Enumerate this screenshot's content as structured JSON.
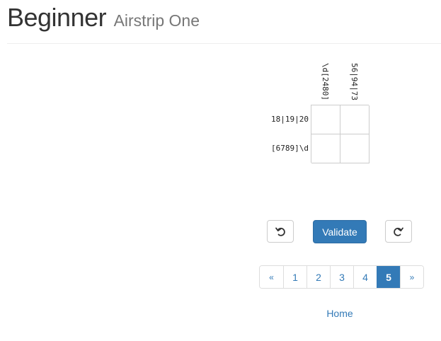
{
  "header": {
    "title": "Beginner",
    "subtitle": "Airstrip One"
  },
  "puzzle": {
    "column_clues": [
      "\\d[2480]",
      "56|94|73"
    ],
    "row_clues": [
      "18|19|20",
      "[6789]\\d"
    ],
    "cells": [
      [
        "",
        ""
      ],
      [
        "",
        ""
      ]
    ]
  },
  "controls": {
    "undo_icon": "undo-icon",
    "redo_icon": "redo-icon",
    "validate_label": "Validate"
  },
  "pagination": {
    "prev": "«",
    "pages": [
      "1",
      "2",
      "3",
      "4",
      "5"
    ],
    "active_page": "5",
    "next": "»"
  },
  "footer": {
    "home_label": "Home"
  },
  "colors": {
    "accent": "#337ab7",
    "grid_border": "#cccccc",
    "text": "#333333",
    "muted": "#777777"
  }
}
